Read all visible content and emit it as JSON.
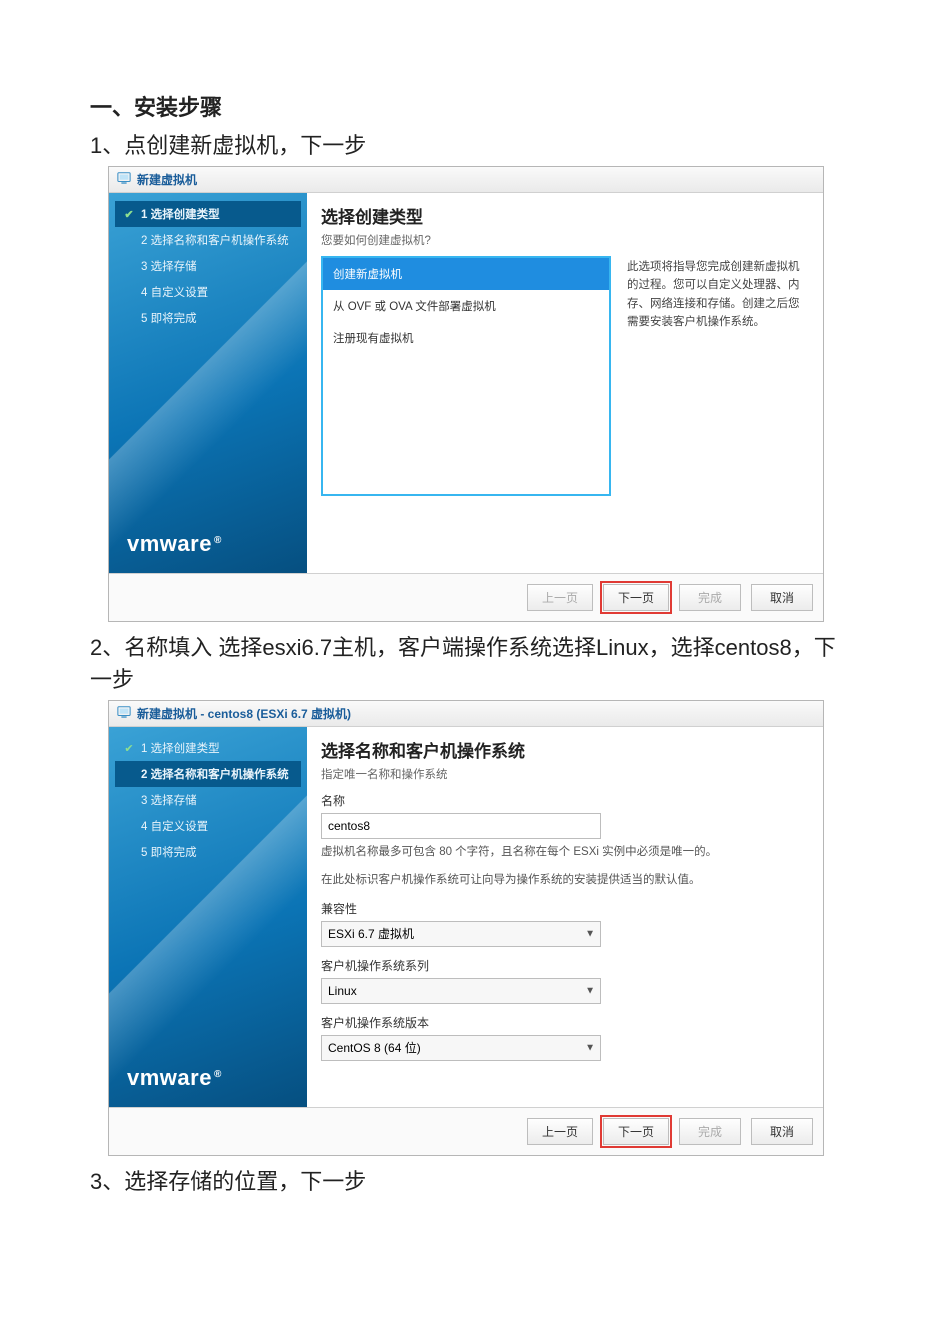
{
  "doc": {
    "section_title": "一、安装步骤",
    "step1_text": "1、点创建新虚拟机，下一步",
    "step2_text": "2、名称填入 选择esxi6.7主机，客户端操作系统选择Linux，选择centos8，下一步",
    "step3_text": "3、选择存储的位置，下一步"
  },
  "wizard1": {
    "title": "新建虚拟机",
    "steps": {
      "s1": "1 选择创建类型",
      "s2": "2 选择名称和客户机操作系统",
      "s3": "3 选择存储",
      "s4": "4 自定义设置",
      "s5": "5 即将完成"
    },
    "content": {
      "title": "选择创建类型",
      "subtitle": "您要如何创建虚拟机?",
      "options": {
        "opt1": "创建新虚拟机",
        "opt2": "从 OVF 或 OVA 文件部署虚拟机",
        "opt3": "注册现有虚拟机"
      },
      "description": "此选项将指导您完成创建新虚拟机的过程。您可以自定义处理器、内存、网络连接和存储。创建之后您需要安装客户机操作系统。"
    },
    "brand": "vmware",
    "buttons": {
      "back": "上一页",
      "next": "下一页",
      "finish": "完成",
      "cancel": "取消"
    }
  },
  "wizard2": {
    "title": "新建虚拟机 - centos8 (ESXi 6.7 虚拟机)",
    "steps": {
      "s1": "1 选择创建类型",
      "s2": "2 选择名称和客户机操作系统",
      "s3": "3 选择存储",
      "s4": "4 自定义设置",
      "s5": "5 即将完成"
    },
    "content": {
      "title": "选择名称和客户机操作系统",
      "subtitle": "指定唯一名称和操作系统",
      "name_label": "名称",
      "name_value": "centos8",
      "name_hint": "虚拟机名称最多可包含 80 个字符，且名称在每个 ESXi 实例中必须是唯一的。",
      "os_hint": "在此处标识客户机操作系统可让向导为操作系统的安装提供适当的默认值。",
      "compat_label": "兼容性",
      "compat_value": "ESXi 6.7 虚拟机",
      "family_label": "客户机操作系统系列",
      "family_value": "Linux",
      "version_label": "客户机操作系统版本",
      "version_value": "CentOS 8 (64 位)"
    },
    "brand": "vmware",
    "buttons": {
      "back": "上一页",
      "next": "下一页",
      "finish": "完成",
      "cancel": "取消"
    }
  }
}
